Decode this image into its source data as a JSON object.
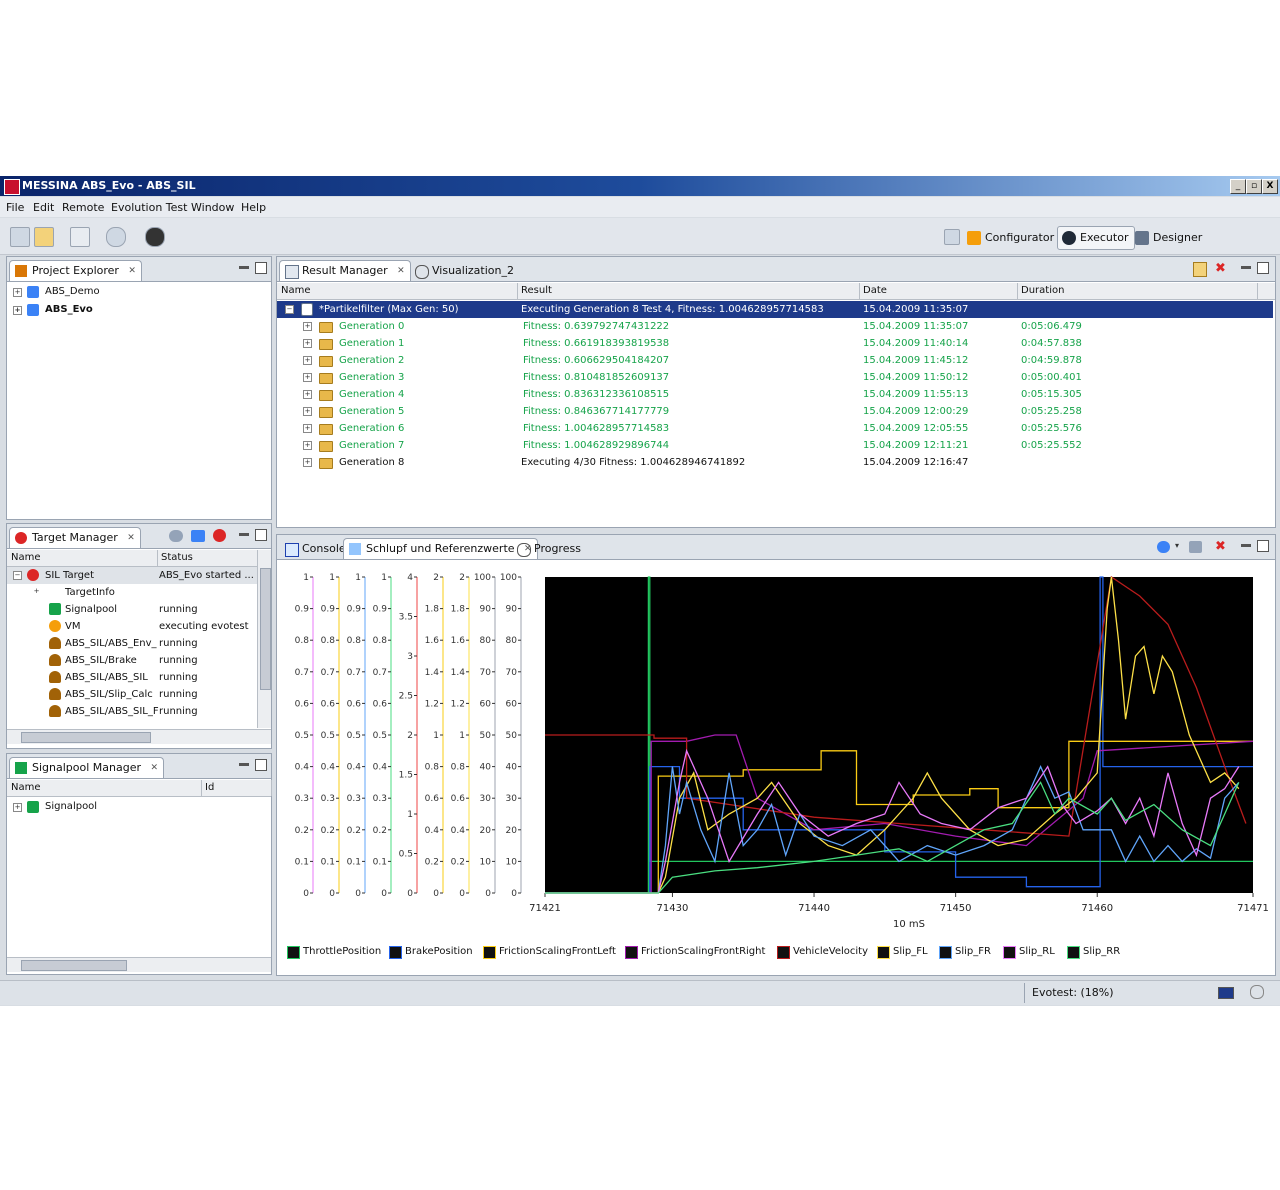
{
  "window": {
    "title": "MESSINA   ABS_Evo - ABS_SIL",
    "controls": [
      "_",
      "▫",
      "X"
    ]
  },
  "menu": [
    "File",
    "Edit",
    "Remote",
    "Evolution Test",
    "Window",
    "Help"
  ],
  "perspectives": [
    "Configurator",
    "Executor",
    "Designer"
  ],
  "project_explorer": {
    "title": "Project Explorer",
    "items": [
      "ABS_Demo",
      "ABS_Evo"
    ]
  },
  "target_manager": {
    "title": "Target Manager",
    "columns": [
      "Name",
      "Status"
    ],
    "rows": [
      {
        "name": "SIL Target",
        "status": "ABS_Evo started ..."
      },
      {
        "name": "TargetInfo",
        "status": ""
      },
      {
        "name": "Signalpool",
        "status": "running"
      },
      {
        "name": "VM",
        "status": "executing evotest"
      },
      {
        "name": "ABS_SIL/ABS_Env_",
        "status": "running"
      },
      {
        "name": "ABS_SIL/Brake",
        "status": "running"
      },
      {
        "name": "ABS_SIL/ABS_SIL",
        "status": "running"
      },
      {
        "name": "ABS_SIL/Slip_Calc",
        "status": "running"
      },
      {
        "name": "ABS_SIL/ABS_SIL_F",
        "status": "running"
      }
    ]
  },
  "signalpool_manager": {
    "title": "Signalpool Manager",
    "columns": [
      "Name",
      "Id"
    ],
    "items": [
      "Signalpool"
    ]
  },
  "result_manager": {
    "tabs": [
      "Result Manager",
      "Visualization_2"
    ],
    "columns": [
      "Name",
      "Result",
      "Date",
      "Duration"
    ],
    "top": {
      "name": "*Partikelfilter (Max Gen: 50)",
      "result": "Executing Generation 8 Test 4, Fitness: 1.004628957714583",
      "date": "15.04.2009 11:35:07",
      "duration": ""
    },
    "rows": [
      {
        "name": "Generation 0",
        "result": "Fitness: 0.639792747431222",
        "date": "15.04.2009 11:35:07",
        "duration": "0:05:06.479"
      },
      {
        "name": "Generation 1",
        "result": "Fitness: 0.661918393819538",
        "date": "15.04.2009 11:40:14",
        "duration": "0:04:57.838"
      },
      {
        "name": "Generation 2",
        "result": "Fitness: 0.606629504184207",
        "date": "15.04.2009 11:45:12",
        "duration": "0:04:59.878"
      },
      {
        "name": "Generation 3",
        "result": "Fitness: 0.810481852609137",
        "date": "15.04.2009 11:50:12",
        "duration": "0:05:00.401"
      },
      {
        "name": "Generation 4",
        "result": "Fitness: 0.836312336108515",
        "date": "15.04.2009 11:55:13",
        "duration": "0:05:15.305"
      },
      {
        "name": "Generation 5",
        "result": "Fitness: 0.846367714177779",
        "date": "15.04.2009 12:00:29",
        "duration": "0:05:25.258"
      },
      {
        "name": "Generation 6",
        "result": "Fitness: 1.004628957714583",
        "date": "15.04.2009 12:05:55",
        "duration": "0:05:25.576"
      },
      {
        "name": "Generation 7",
        "result": "Fitness: 1.004628929896744",
        "date": "15.04.2009 12:11:21",
        "duration": "0:05:25.552"
      },
      {
        "name": "Generation 8",
        "result": "Executing 4/30 Fitness: 1.004628946741892",
        "date": "15.04.2009 12:16:47",
        "duration": ""
      }
    ]
  },
  "bottom_tabs": [
    "Console",
    "Schlupf und Referenzwerte",
    "Progress"
  ],
  "chart_data": {
    "type": "line",
    "xlabel": "10 mS",
    "x_ticks": [
      "71421",
      "71430",
      "71440",
      "71450",
      "71460",
      "71471"
    ],
    "xlim": [
      71421,
      71471
    ],
    "axes": [
      {
        "ticks": [
          "1",
          "0.9",
          "0.8",
          "0.7",
          "0.6",
          "0.5",
          "0.4",
          "0.3",
          "0.2",
          "0.1",
          "0"
        ],
        "color": "#e879f9"
      },
      {
        "ticks": [
          "1",
          "0.9",
          "0.8",
          "0.7",
          "0.6",
          "0.5",
          "0.4",
          "0.3",
          "0.2",
          "0.1",
          "0"
        ],
        "color": "#facc15"
      },
      {
        "ticks": [
          "1",
          "0.9",
          "0.8",
          "0.7",
          "0.6",
          "0.5",
          "0.4",
          "0.3",
          "0.2",
          "0.1",
          "0"
        ],
        "color": "#60a5fa"
      },
      {
        "ticks": [
          "1",
          "0.9",
          "0.8",
          "0.7",
          "0.6",
          "0.5",
          "0.4",
          "0.3",
          "0.2",
          "0.1",
          "0"
        ],
        "color": "#4ade80"
      },
      {
        "ticks": [
          "4",
          "3.5",
          "3",
          "2.5",
          "2",
          "1.5",
          "1",
          "0.5",
          "0"
        ],
        "color": "#ef4444"
      },
      {
        "ticks": [
          "2",
          "1.8",
          "1.6",
          "1.4",
          "1.2",
          "1",
          "0.8",
          "0.6",
          "0.4",
          "0.2",
          "0"
        ],
        "color": "#facc15"
      },
      {
        "ticks": [
          "2",
          "1.8",
          "1.6",
          "1.4",
          "1.2",
          "1",
          "0.8",
          "0.6",
          "0.4",
          "0.2",
          "0"
        ],
        "color": "#fde047"
      },
      {
        "ticks": [
          "100",
          "90",
          "80",
          "70",
          "60",
          "50",
          "40",
          "30",
          "20",
          "10",
          "0"
        ],
        "color": "#9ca3af"
      },
      {
        "ticks": [
          "100",
          "90",
          "80",
          "70",
          "60",
          "50",
          "40",
          "30",
          "20",
          "10",
          "0"
        ],
        "color": "#9ca3af"
      }
    ],
    "series": [
      {
        "name": "ThrottlePosition",
        "color": "#22c55e",
        "points": [
          [
            71421,
            0
          ],
          [
            71428.3,
            0
          ],
          [
            71428.3,
            1
          ],
          [
            71428.4,
            1
          ],
          [
            71428.4,
            0.1
          ],
          [
            71429,
            0.1
          ],
          [
            71471,
            0.1
          ]
        ]
      },
      {
        "name": "BrakePosition",
        "color": "#2563eb",
        "points": [
          [
            71421,
            0
          ],
          [
            71428.4,
            0
          ],
          [
            71428.4,
            0.4
          ],
          [
            71430.5,
            0.4
          ],
          [
            71430.5,
            0.3
          ],
          [
            71435,
            0.3
          ],
          [
            71435,
            0.2
          ],
          [
            71445,
            0.2
          ],
          [
            71445,
            0.13
          ],
          [
            71450,
            0.13
          ],
          [
            71450,
            0.05
          ],
          [
            71455,
            0.05
          ],
          [
            71455,
            0.02
          ],
          [
            71460.2,
            0.02
          ],
          [
            71460.2,
            1
          ],
          [
            71460.4,
            1
          ],
          [
            71460.4,
            0.4
          ],
          [
            71471,
            0.4
          ]
        ]
      },
      {
        "name": "FrictionScalingFrontLeft",
        "color": "#facc15",
        "points": [
          [
            71421,
            0
          ],
          [
            71429,
            0
          ],
          [
            71429,
            0.37
          ],
          [
            71435,
            0.37
          ],
          [
            71435,
            0.39
          ],
          [
            71440.5,
            0.39
          ],
          [
            71440.5,
            0.45
          ],
          [
            71443,
            0.45
          ],
          [
            71443,
            0.28
          ],
          [
            71447,
            0.28
          ],
          [
            71447,
            0.31
          ],
          [
            71451,
            0.31
          ],
          [
            71451,
            0.33
          ],
          [
            71453,
            0.33
          ],
          [
            71453,
            0.27
          ],
          [
            71458,
            0.27
          ],
          [
            71458,
            0.48
          ],
          [
            71471,
            0.48
          ]
        ]
      },
      {
        "name": "FrictionScalingFrontRight",
        "color": "#a21caf",
        "points": [
          [
            71421,
            0
          ],
          [
            71428.5,
            0
          ],
          [
            71428.5,
            0.48
          ],
          [
            71431,
            0.48
          ],
          [
            71433,
            0.5
          ],
          [
            71434.5,
            0.5
          ],
          [
            71436,
            0.3
          ],
          [
            71440,
            0.2
          ],
          [
            71445,
            0.22
          ],
          [
            71450,
            0.18
          ],
          [
            71455,
            0.15
          ],
          [
            71459,
            0.3
          ],
          [
            71460,
            0.45
          ],
          [
            71471,
            0.48
          ]
        ]
      },
      {
        "name": "VehicleVelocity",
        "color": "#b91c1c",
        "points": [
          [
            71421,
            50
          ],
          [
            71428.7,
            50
          ],
          [
            71428.7,
            49
          ],
          [
            71431,
            49
          ],
          [
            71431,
            30
          ],
          [
            71434,
            28
          ],
          [
            71440,
            24
          ],
          [
            71446,
            22
          ],
          [
            71452,
            20
          ],
          [
            71458,
            18
          ],
          [
            71461,
            100
          ],
          [
            71463,
            94
          ],
          [
            71465,
            85
          ],
          [
            71467,
            65
          ],
          [
            71469,
            40
          ],
          [
            71470.5,
            22
          ]
        ]
      },
      {
        "name": "Slip_FL",
        "color": "#fde047",
        "points": [
          [
            71421,
            0
          ],
          [
            71429,
            0
          ],
          [
            71429.5,
            0.05
          ],
          [
            71430.5,
            0.3
          ],
          [
            71431.5,
            0.38
          ],
          [
            71432.5,
            0.2
          ],
          [
            71434,
            0.25
          ],
          [
            71436,
            0.3
          ],
          [
            71437,
            0.35
          ],
          [
            71439,
            0.22
          ],
          [
            71441,
            0.15
          ],
          [
            71443,
            0.12
          ],
          [
            71445,
            0.2
          ],
          [
            71446,
            0.25
          ],
          [
            71447,
            0.3
          ],
          [
            71448,
            0.38
          ],
          [
            71449,
            0.3
          ],
          [
            71451,
            0.2
          ],
          [
            71453,
            0.15
          ],
          [
            71455,
            0.17
          ],
          [
            71457,
            0.25
          ],
          [
            71458.5,
            0.3
          ],
          [
            71460,
            0.38
          ],
          [
            71460.7,
            0.9
          ],
          [
            71461,
            1
          ],
          [
            71461.5,
            0.8
          ],
          [
            71462,
            0.55
          ],
          [
            71462.7,
            0.75
          ],
          [
            71463.3,
            0.78
          ],
          [
            71464,
            0.63
          ],
          [
            71464.6,
            0.75
          ],
          [
            71465.3,
            0.7
          ],
          [
            71466.5,
            0.5
          ],
          [
            71468,
            0.35
          ],
          [
            71469,
            0.38
          ],
          [
            71470,
            0.33
          ]
        ]
      },
      {
        "name": "Slip_FR",
        "color": "#60a5fa",
        "points": [
          [
            71421,
            0
          ],
          [
            71429,
            0
          ],
          [
            71429.5,
            0.15
          ],
          [
            71430,
            0.4
          ],
          [
            71430.5,
            0.25
          ],
          [
            71431,
            0.35
          ],
          [
            71432,
            0.2
          ],
          [
            71433,
            0.1
          ],
          [
            71434,
            0.38
          ],
          [
            71435,
            0.15
          ],
          [
            71436,
            0.2
          ],
          [
            71437,
            0.28
          ],
          [
            71438,
            0.12
          ],
          [
            71439,
            0.25
          ],
          [
            71440,
            0.18
          ],
          [
            71442,
            0.15
          ],
          [
            71444,
            0.2
          ],
          [
            71446,
            0.1
          ],
          [
            71448,
            0.15
          ],
          [
            71450,
            0.12
          ],
          [
            71452,
            0.15
          ],
          [
            71454,
            0.2
          ],
          [
            71456,
            0.4
          ],
          [
            71457,
            0.3
          ],
          [
            71458,
            0.32
          ],
          [
            71459,
            0.2
          ],
          [
            71461,
            0.2
          ],
          [
            71462,
            0.1
          ],
          [
            71463,
            0.18
          ],
          [
            71464,
            0.1
          ],
          [
            71465,
            0.15
          ],
          [
            71466,
            0.1
          ],
          [
            71467,
            0.14
          ],
          [
            71468,
            0.11
          ],
          [
            71469,
            0.3
          ],
          [
            71470,
            0.35
          ]
        ]
      },
      {
        "name": "Slip_RL",
        "color": "#e879f9",
        "points": [
          [
            71421,
            0
          ],
          [
            71429,
            0
          ],
          [
            71429.5,
            0.1
          ],
          [
            71430.5,
            0.35
          ],
          [
            71431,
            0.45
          ],
          [
            71432.5,
            0.3
          ],
          [
            71434,
            0.1
          ],
          [
            71436,
            0.25
          ],
          [
            71437.5,
            0.35
          ],
          [
            71439,
            0.25
          ],
          [
            71441,
            0.18
          ],
          [
            71443,
            0.22
          ],
          [
            71445,
            0.25
          ],
          [
            71446,
            0.35
          ],
          [
            71447.5,
            0.25
          ],
          [
            71449,
            0.22
          ],
          [
            71451,
            0.2
          ],
          [
            71453,
            0.27
          ],
          [
            71455,
            0.3
          ],
          [
            71456.5,
            0.4
          ],
          [
            71457.5,
            0.28
          ],
          [
            71458.5,
            0.22
          ],
          [
            71460,
            0.26
          ],
          [
            71461,
            0.3
          ],
          [
            71462,
            0.22
          ],
          [
            71463,
            0.3
          ],
          [
            71464,
            0.18
          ],
          [
            71465,
            0.38
          ],
          [
            71466,
            0.22
          ],
          [
            71467,
            0.12
          ],
          [
            71468,
            0.3
          ],
          [
            71469,
            0.33
          ],
          [
            71470,
            0.4
          ]
        ]
      },
      {
        "name": "Slip_RR",
        "color": "#4ade80",
        "points": [
          [
            71421,
            0
          ],
          [
            71429,
            0
          ],
          [
            71430,
            0.05
          ],
          [
            71433,
            0.07
          ],
          [
            71436,
            0.08
          ],
          [
            71440,
            0.1
          ],
          [
            71443,
            0.12
          ],
          [
            71446,
            0.14
          ],
          [
            71448,
            0.1
          ],
          [
            71450,
            0.15
          ],
          [
            71452,
            0.2
          ],
          [
            71454,
            0.22
          ],
          [
            71456,
            0.35
          ],
          [
            71457,
            0.25
          ],
          [
            71458,
            0.3
          ],
          [
            71460,
            0.25
          ],
          [
            71461,
            0.3
          ],
          [
            71462,
            0.23
          ],
          [
            71464,
            0.28
          ],
          [
            71466,
            0.2
          ],
          [
            71468,
            0.15
          ],
          [
            71469,
            0.25
          ],
          [
            71470,
            0.35
          ]
        ]
      }
    ]
  },
  "legend": [
    "ThrottlePosition",
    "BrakePosition",
    "FrictionScalingFrontLeft",
    "FrictionScalingFrontRight",
    "VehicleVelocity",
    "Slip_FL",
    "Slip_FR",
    "Slip_RL",
    "Slip_RR"
  ],
  "status": "Evotest: (18%)",
  "colors": {
    "title_start": "#0a246a",
    "selection": "#1e3a8a",
    "fitness_green": "#16a34a"
  }
}
